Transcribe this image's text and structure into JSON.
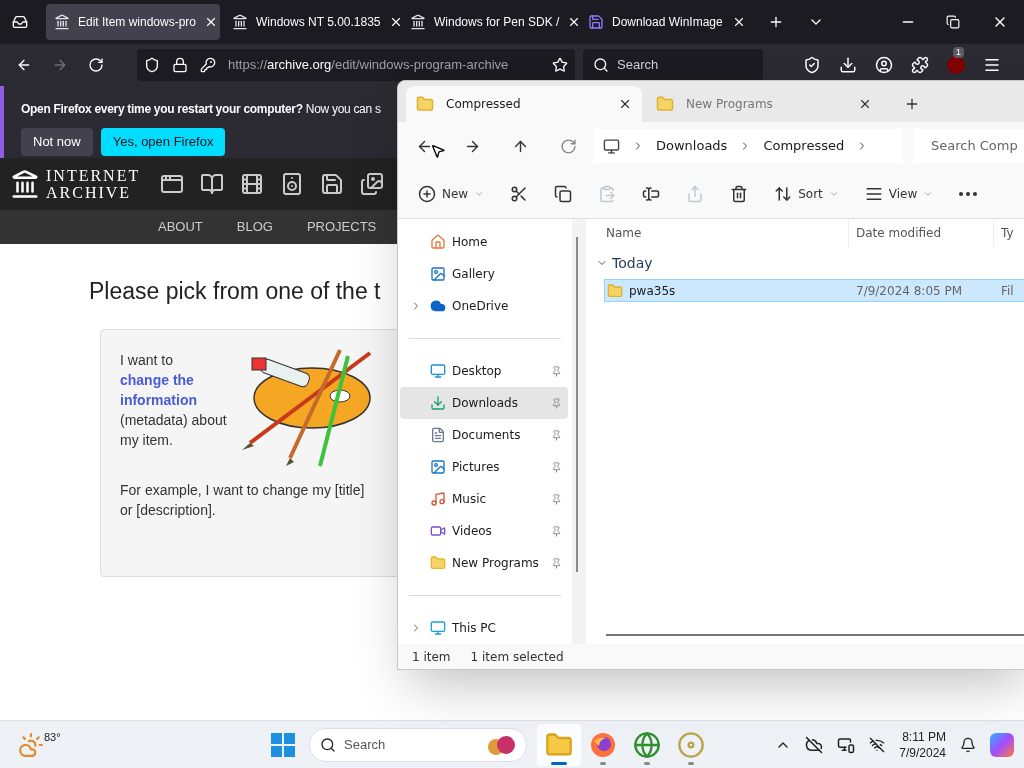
{
  "browser": {
    "tabs": [
      {
        "title": "Edit Item windows-pro",
        "kind": "archive",
        "selected": true
      },
      {
        "title": "Windows NT 5.00.1835",
        "kind": "archive",
        "selected": false
      },
      {
        "title": "Windows for Pen SDK /",
        "kind": "archive",
        "selected": false
      },
      {
        "title": "Download WinImage",
        "kind": "floppy",
        "selected": false
      }
    ],
    "url": {
      "scheme": "https://",
      "host": "archive.org",
      "path": "/edit/windows-program-archive"
    },
    "search": {
      "placeholder": "Search"
    },
    "extension_badge": "1",
    "notification": {
      "bold": "Open Firefox every time you restart your computer?",
      "text": "Now you can s",
      "buttons": [
        {
          "label": "Not now",
          "kind": "secondary"
        },
        {
          "label": "Yes, open Firefox",
          "kind": "primary"
        }
      ]
    }
  },
  "site": {
    "logo": [
      "INTERNET",
      "ARCHIVE"
    ],
    "nav": [
      "ABOUT",
      "BLOG",
      "PROJECTS"
    ],
    "heading": "Please pick from one of the t",
    "card": {
      "intro": "I want to",
      "link": "change the information",
      "after": "(metadata) about my item.",
      "example": "For example, I want to change my [title] or [description]."
    }
  },
  "explorer": {
    "tabs": [
      {
        "title": "Compressed",
        "selected": true
      },
      {
        "title": "New Programs",
        "selected": false
      }
    ],
    "breadcrumb": [
      "Downloads",
      "Compressed"
    ],
    "search": {
      "placeholder": "Search Comp"
    },
    "commands": [
      {
        "kind": "new",
        "label": "New",
        "disabled": false
      },
      {
        "kind": "cut",
        "disabled": false
      },
      {
        "kind": "copy",
        "disabled": false
      },
      {
        "kind": "paste",
        "disabled": true
      },
      {
        "kind": "rename",
        "disabled": false
      },
      {
        "kind": "share",
        "disabled": true
      },
      {
        "kind": "delete",
        "disabled": false
      },
      {
        "kind": "sort",
        "label": "Sort",
        "disabled": false
      },
      {
        "kind": "view",
        "label": "View",
        "disabled": false
      },
      {
        "kind": "more",
        "disabled": false
      }
    ],
    "sidebar": [
      {
        "items": [
          {
            "label": "Home",
            "kind": "home",
            "expandable": false,
            "pinned": false,
            "selected": false
          },
          {
            "label": "Gallery",
            "kind": "gallery",
            "expandable": false,
            "pinned": false,
            "selected": false
          },
          {
            "label": "OneDrive",
            "kind": "cloud",
            "expandable": true,
            "pinned": false,
            "selected": false
          }
        ]
      },
      {
        "items": [
          {
            "label": "Desktop",
            "kind": "desktop",
            "expandable": false,
            "pinned": true,
            "selected": false
          },
          {
            "label": "Downloads",
            "kind": "downloads",
            "expandable": false,
            "pinned": true,
            "selected": true
          },
          {
            "label": "Documents",
            "kind": "documents",
            "expandable": false,
            "pinned": true,
            "selected": false
          },
          {
            "label": "Pictures",
            "kind": "pictures",
            "expandable": false,
            "pinned": true,
            "selected": false
          },
          {
            "label": "Music",
            "kind": "music",
            "expandable": false,
            "pinned": true,
            "selected": false
          },
          {
            "label": "Videos",
            "kind": "videos",
            "expandable": false,
            "pinned": true,
            "selected": false
          },
          {
            "label": "New Programs",
            "kind": "folder",
            "expandable": false,
            "pinned": true,
            "selected": false
          }
        ]
      },
      {
        "items": [
          {
            "label": "This PC",
            "kind": "pc",
            "expandable": true,
            "pinned": false,
            "selected": false
          }
        ]
      }
    ],
    "columns": [
      "Name",
      "Date modified",
      "Ty"
    ],
    "groups": [
      {
        "label": "Today",
        "expanded": true,
        "rows": [
          {
            "name": "pwa35s",
            "date": "7/9/2024 8:05 PM",
            "type": "Fil",
            "selected": true
          }
        ]
      }
    ],
    "status": [
      "1 item",
      "1 item selected"
    ]
  },
  "taskbar": {
    "weather": "83°",
    "search": {
      "placeholder": "Search"
    },
    "apps": [
      {
        "kind": "explorer",
        "active": true
      },
      {
        "kind": "firefox",
        "active": false
      },
      {
        "kind": "globe",
        "active": false
      },
      {
        "kind": "disc",
        "active": false
      }
    ],
    "time": "8:11 PM",
    "date": "7/9/2024"
  }
}
